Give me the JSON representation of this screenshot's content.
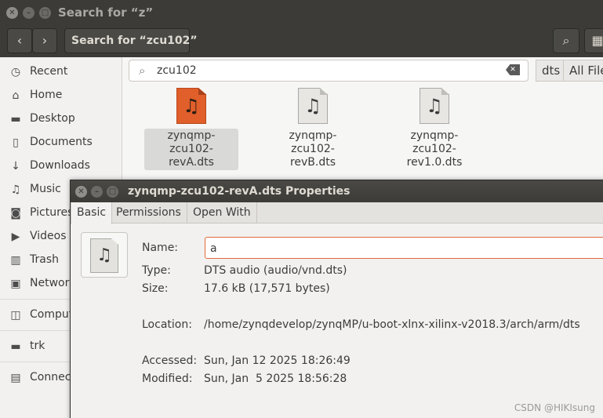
{
  "file_manager": {
    "title": "Search for “z”",
    "path_button": "Search for “zcu102”",
    "search": {
      "value": "zcu102"
    },
    "filter_chips": [
      "dts",
      "All File"
    ],
    "sidebar": [
      {
        "label": "Recent",
        "icon": "clock-icon"
      },
      {
        "label": "Home",
        "icon": "home-icon"
      },
      {
        "label": "Desktop",
        "icon": "folder-icon"
      },
      {
        "label": "Documents",
        "icon": "document-icon"
      },
      {
        "label": "Downloads",
        "icon": "download-icon"
      },
      {
        "label": "Music",
        "icon": "music-icon"
      },
      {
        "label": "Pictures",
        "icon": "camera-icon"
      },
      {
        "label": "Videos",
        "icon": "video-icon"
      },
      {
        "label": "Trash",
        "icon": "trash-icon"
      },
      {
        "label": "Network",
        "icon": "network-icon"
      },
      {
        "label": "Computer",
        "icon": "drive-icon"
      },
      {
        "label": "trk",
        "icon": "folder-icon"
      },
      {
        "label": "Connect to Server",
        "icon": "server-icon"
      }
    ],
    "files": [
      {
        "name_line1": "zynqmp-zcu102-",
        "name_line2": "revA.dts",
        "selected": true
      },
      {
        "name_line1": "zynqmp-zcu102-",
        "name_line2": "revB.dts",
        "selected": false
      },
      {
        "name_line1": "zynqmp-zcu102-",
        "name_line2": "rev1.0.dts",
        "selected": false
      }
    ]
  },
  "properties": {
    "title": "zynqmp-zcu102-revA.dts Properties",
    "tabs": [
      "Basic",
      "Permissions",
      "Open With"
    ],
    "active_tab": "Basic",
    "labels": {
      "name": "Name:",
      "type": "Type:",
      "size": "Size:",
      "location": "Location:",
      "accessed": "Accessed:",
      "modified": "Modified:"
    },
    "values": {
      "name": "a",
      "type": "DTS audio (audio/vnd.dts)",
      "size": "17.6 kB (17,571 bytes)",
      "location": "/home/zynqdevelop/zynqMP/u-boot-xlnx-xilinx-v2018.3/arch/arm/dts",
      "accessed": "Sun, Jan 12 2025 18:26:49",
      "modified": "Sun, Jan  5 2025 18:56:28"
    }
  },
  "watermark": "CSDN @HIKIsung",
  "colors": {
    "titlebar": "#3c3b37",
    "selected_file": "#e05f2a",
    "focus_border": "#e26a3a"
  }
}
